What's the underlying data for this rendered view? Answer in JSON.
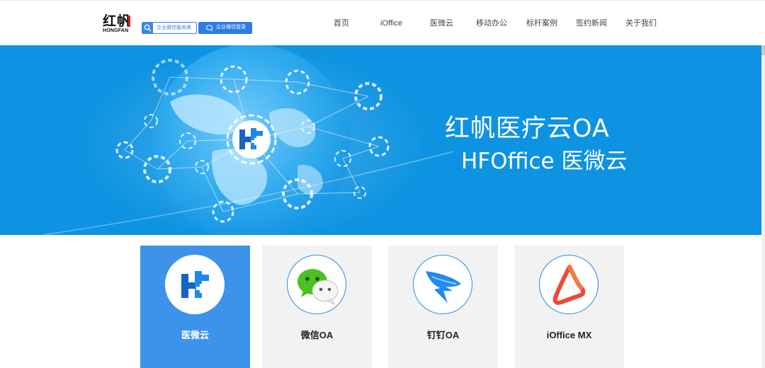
{
  "logo": {
    "main_text": "红帆",
    "sub_text": "HONGFAN"
  },
  "header": {
    "search_placeholder": "企业微信服务商",
    "login_label": "企业微信登录"
  },
  "nav": {
    "items": [
      {
        "label": "首页"
      },
      {
        "label": "iOffice"
      },
      {
        "label": "医微云"
      },
      {
        "label": "移动办公"
      },
      {
        "label": "标杆案例"
      },
      {
        "label": "签约新闻"
      },
      {
        "label": "关于我们"
      }
    ]
  },
  "banner": {
    "title": "红帆医疗云OA",
    "subtitle": "HFOffice 医微云",
    "background_color": "#0d93e2"
  },
  "cards": [
    {
      "label": "医微云",
      "icon": "hf-logo-icon",
      "active": true
    },
    {
      "label": "微信OA",
      "icon": "wechat-icon",
      "active": false
    },
    {
      "label": "钉钉OA",
      "icon": "dingtalk-icon",
      "active": false
    },
    {
      "label": "iOffice MX",
      "icon": "ioffice-mx-icon",
      "active": false
    }
  ],
  "colors": {
    "accent": "#2f7de3",
    "card_active": "#3d93ea",
    "card_inactive": "#f2f2f2"
  }
}
